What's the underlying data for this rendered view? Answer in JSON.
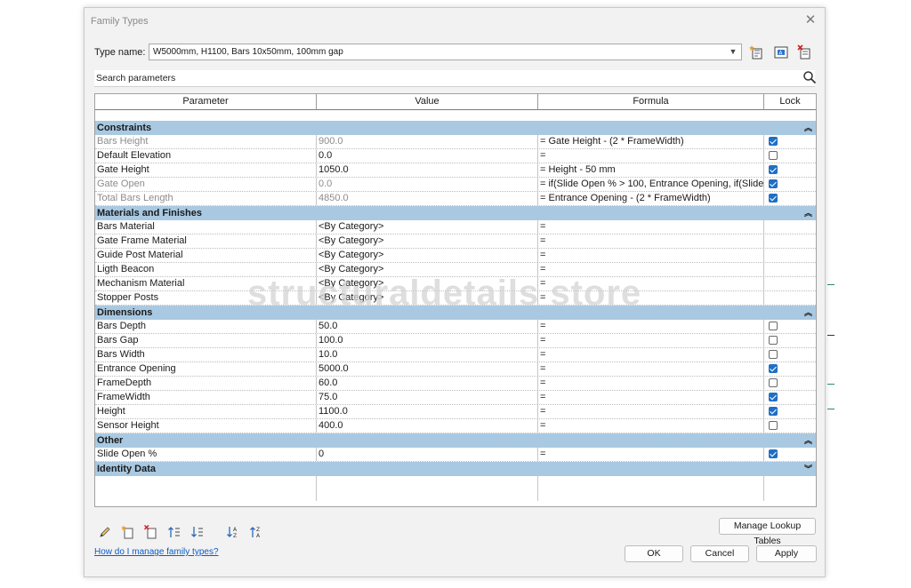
{
  "dialog": {
    "title": "Family Types",
    "close_glyph": "✕",
    "type_name_label": "Type name:",
    "type_name_value": "W5000mm, H1100, Bars 10x50mm, 100mm gap",
    "toolbar_icons": [
      "new-type-icon",
      "rename-type-icon",
      "delete-type-icon"
    ],
    "search_placeholder": "Search parameters"
  },
  "grid": {
    "headers": [
      "Parameter",
      "Value",
      "Formula",
      "Lock"
    ],
    "groups": [
      {
        "name": "Constraints",
        "chevron": "︽",
        "rows": [
          {
            "param": "Bars Height",
            "value": "900.0",
            "formula": "= Gate Height - (2 * FrameWidth)",
            "lock": true,
            "greyed": true
          },
          {
            "param": "Default Elevation",
            "value": "0.0",
            "formula": "=",
            "lock": false,
            "greyed": false
          },
          {
            "param": "Gate Height",
            "value": "1050.0",
            "formula": "= Height - 50 mm",
            "lock": true,
            "greyed": false
          },
          {
            "param": "Gate Open",
            "value": "0.0",
            "formula": "= if(Slide Open % > 100, Entrance Opening, if(Slide O",
            "lock": true,
            "greyed": true
          },
          {
            "param": "Total Bars Length",
            "value": "4850.0",
            "formula": "= Entrance Opening - (2 * FrameWidth)",
            "lock": true,
            "greyed": true
          }
        ]
      },
      {
        "name": "Materials and Finishes",
        "chevron": "︽",
        "rows": [
          {
            "param": "Bars Material",
            "value": "<By Category>",
            "formula": "=",
            "lock": null,
            "greyed": false
          },
          {
            "param": "Gate Frame Material",
            "value": "<By Category>",
            "formula": "=",
            "lock": null,
            "greyed": false
          },
          {
            "param": "Guide Post Material",
            "value": "<By Category>",
            "formula": "=",
            "lock": null,
            "greyed": false
          },
          {
            "param": "Ligth Beacon",
            "value": "<By Category>",
            "formula": "=",
            "lock": null,
            "greyed": false
          },
          {
            "param": "Mechanism Material",
            "value": "<By Category>",
            "formula": "=",
            "lock": null,
            "greyed": false
          },
          {
            "param": "Stopper Posts",
            "value": "<By Category>",
            "formula": "=",
            "lock": null,
            "greyed": false
          }
        ]
      },
      {
        "name": "Dimensions",
        "chevron": "︽",
        "rows": [
          {
            "param": "Bars Depth",
            "value": "50.0",
            "formula": "=",
            "lock": false,
            "greyed": false
          },
          {
            "param": "Bars Gap",
            "value": "100.0",
            "formula": "=",
            "lock": false,
            "greyed": false
          },
          {
            "param": "Bars Width",
            "value": "10.0",
            "formula": "=",
            "lock": false,
            "greyed": false
          },
          {
            "param": "Entrance Opening",
            "value": "5000.0",
            "formula": "=",
            "lock": true,
            "greyed": false
          },
          {
            "param": "FrameDepth",
            "value": "60.0",
            "formula": "=",
            "lock": false,
            "greyed": false
          },
          {
            "param": "FrameWidth",
            "value": "75.0",
            "formula": "=",
            "lock": true,
            "greyed": false
          },
          {
            "param": "Height",
            "value": "1100.0",
            "formula": "=",
            "lock": true,
            "greyed": false
          },
          {
            "param": "Sensor Height",
            "value": "400.0",
            "formula": "=",
            "lock": false,
            "greyed": false
          }
        ]
      },
      {
        "name": "Other",
        "chevron": "︽",
        "rows": [
          {
            "param": "Slide Open %",
            "value": "0",
            "formula": "=",
            "lock": true,
            "greyed": false
          }
        ]
      },
      {
        "name": "Identity Data",
        "chevron": "︾",
        "rows": []
      }
    ]
  },
  "watermark": "structuraldetails store",
  "bottom_tools": [
    "edit-pencil-icon",
    "new-parameter-icon",
    "delete-parameter-icon",
    "move-up-icon",
    "move-down-icon",
    "sort-ascending-icon",
    "sort-descending-icon"
  ],
  "buttons": {
    "manage_lookup": "Manage Lookup Tables",
    "ok": "OK",
    "cancel": "Cancel",
    "apply": "Apply"
  },
  "help_link": "How do I manage family types?",
  "colors": {
    "group_header": "#a9c9e2",
    "check_on": "#1f6fc5",
    "link": "#0a5cc7"
  }
}
